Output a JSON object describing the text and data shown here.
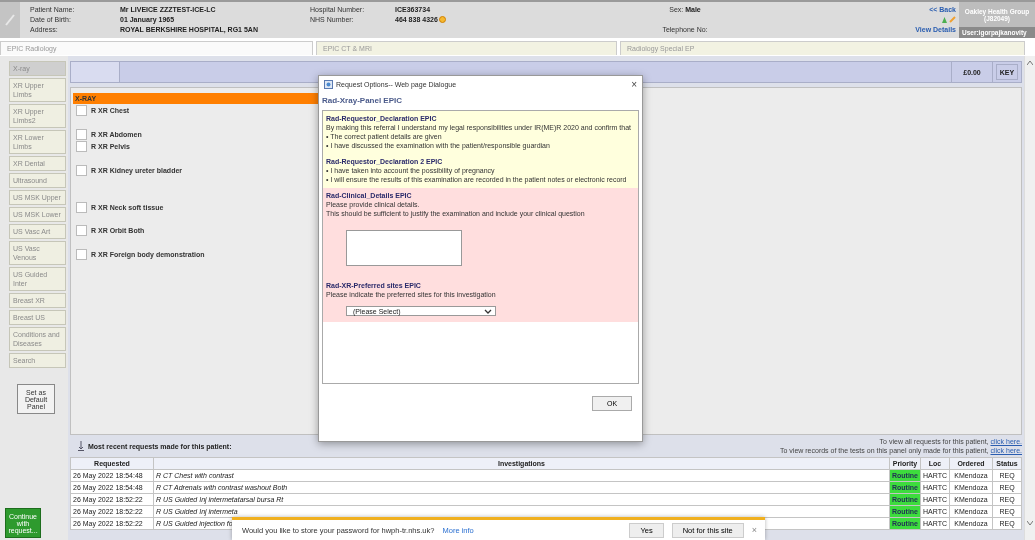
{
  "patient": {
    "fields": [
      {
        "label": "Patient Name:",
        "value": "Mr LIVEICE ZZZTEST-ICE-LC"
      },
      {
        "label": "Hospital Number:",
        "value": "ICE363734"
      },
      {
        "label": "Date of Birth:",
        "value": "01 January 1965"
      },
      {
        "label": "NHS Number:",
        "value": "464 838 4326"
      },
      {
        "label": "Address:",
        "value": "ROYAL BERKSHIRE HOSPITAL, RG1 5AN"
      }
    ],
    "sex": {
      "label": "Sex:",
      "value": "Male"
    },
    "telephone": {
      "label": "Telephone No:"
    }
  },
  "header_links": {
    "back": "<< Back",
    "view_details": "View Details"
  },
  "organisation": {
    "name": "Oakley Health Group",
    "code": "(J82049)",
    "user": "User:igorpajkanovity"
  },
  "panel_tabs": [
    {
      "label": "EPIC Radiology",
      "selected": true
    },
    {
      "label": "EPIC CT & MRI",
      "selected": false
    },
    {
      "label": "Radiology Special EP",
      "selected": false
    }
  ],
  "sidebar": {
    "items": [
      {
        "label": "X-ray",
        "selected": true
      },
      {
        "label": "XR Upper Limbs",
        "selected": false
      },
      {
        "label": "XR Upper Limbs2",
        "selected": false
      },
      {
        "label": "XR Lower Limbs",
        "selected": false
      },
      {
        "label": "XR Dental",
        "selected": false
      },
      {
        "label": "Ultrasound",
        "selected": false
      },
      {
        "label": "US MSK Upper",
        "selected": false
      },
      {
        "label": "US MSK Lower",
        "selected": false
      },
      {
        "label": "US Vasc Art",
        "selected": false
      },
      {
        "label": "US Vasc Venous",
        "selected": false
      },
      {
        "label": "US Guided Inter",
        "selected": false
      },
      {
        "label": "Breast XR",
        "selected": false
      },
      {
        "label": "Breast US",
        "selected": false
      },
      {
        "label": "Conditions and Diseases",
        "selected": false
      },
      {
        "label": "Search",
        "selected": false
      }
    ],
    "set_default": "Set as Default Panel",
    "continue": "Continue with request..."
  },
  "toolbar": {
    "price": "£0.00",
    "key": "KEY"
  },
  "xray": {
    "heading": "X-RAY",
    "tests": [
      {
        "label": "R XR Chest",
        "checked": false
      },
      {
        "label": "R XR Abdomen",
        "checked": false
      },
      {
        "label": "R XR Pelvis",
        "checked": false
      },
      {
        "label": "R XR Kidney ureter bladder",
        "checked": false
      },
      {
        "label": "R XR Neck soft tissue",
        "checked": false
      },
      {
        "label": "R XR Orbit Both",
        "checked": false
      },
      {
        "label": "R XR Foreign body demonstration",
        "checked": false
      }
    ]
  },
  "dialog": {
    "title": "Request Options-- Web page Dialogue",
    "close": "×",
    "heading": "Rad-Xray-Panel EPIC",
    "sections": [
      {
        "kind": "declaration",
        "title": "Rad-Requestor_Declaration EPIC",
        "lines": [
          "By making this referral I understand my legal responsibilities under IR(ME)R 2020 and confirm that",
          "• The correct patient details are given",
          "• I have discussed the examination with the patient/responsible guardian"
        ]
      },
      {
        "kind": "declaration",
        "title": "Rad-Requestor_Declaration 2 EPIC",
        "lines": [
          "• I have taken into account the possibility of pregnancy",
          "• I will ensure the results of this examination are recorded in the patient notes or electronic record"
        ]
      },
      {
        "kind": "text",
        "title": "Rad-Clinical_Details EPIC",
        "lines": [
          "Please provide clinical details.",
          "This should be sufficient to justify the examination and include your clinical question"
        ]
      },
      {
        "kind": "select",
        "title": "Rad-XR-Preferred sites EPIC",
        "lines": [
          "Please indicate the preferred sites for this investigation"
        ],
        "value": "(Please Select)"
      }
    ],
    "ok": "OK"
  },
  "recent": {
    "title": "Most recent requests made for this patient:",
    "links": [
      {
        "text": "To view all requests for this patient, ",
        "link": "click here."
      },
      {
        "text": "To view records of the tests on this panel only made for this patient, ",
        "link": "click here."
      }
    ],
    "columns": [
      "Requested",
      "Investigations",
      "Priority",
      "Loc",
      "Ordered",
      "Status"
    ],
    "rows": [
      {
        "requested": "26 May 2022 18:54:48",
        "investigation": "R CT Chest with contrast",
        "priority": "Routine",
        "color": "#3ddc3d",
        "loc": "HARTC",
        "ordered": "KMendoza",
        "status": "REQ"
      },
      {
        "requested": "26 May 2022 18:54:48",
        "investigation": "R CT Adrenals with contrast washout Both",
        "priority": "Routine",
        "color": "#3ddc3d",
        "loc": "HARTC",
        "ordered": "KMendoza",
        "status": "REQ"
      },
      {
        "requested": "26 May 2022 18:52:22",
        "investigation": "R US Guided Inj intermetatarsal bursa Rt",
        "priority": "Routine",
        "color": "#3ddc3d",
        "loc": "HARTC",
        "ordered": "KMendoza",
        "status": "REQ"
      },
      {
        "requested": "26 May 2022 18:52:22",
        "investigation": "R US Guided Inj intermeta",
        "priority": "Routine",
        "color": "#3ddc3d",
        "loc": "HARTC",
        "ordered": "KMendoza",
        "status": "REQ"
      },
      {
        "requested": "26 May 2022 18:52:22",
        "investigation": "R US Guided injection fo",
        "priority": "Routine",
        "color": "#3ddc3d",
        "loc": "HARTC",
        "ordered": "KMendoza",
        "status": "REQ"
      }
    ]
  },
  "password_bar": {
    "message": "Would you like to store your password for hwph-tr.nhs.uk?",
    "more_info": "More info",
    "yes": "Yes",
    "no": "Not for this site",
    "close": "×"
  }
}
